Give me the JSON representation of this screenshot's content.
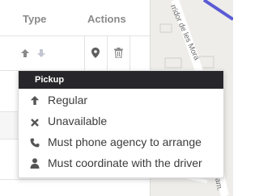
{
  "table": {
    "headers": {
      "type": "Type",
      "actions": "Actions"
    }
  },
  "icons": {
    "arrow_up": "arrow-up-icon",
    "arrow_down": "arrow-down-icon",
    "pin": "map-pin-icon",
    "trash": "trash-icon"
  },
  "map": {
    "street_label_1": "rridor de les Mora",
    "street_label_2": "am."
  },
  "menu": {
    "header": "Pickup",
    "items": [
      {
        "label": "Regular",
        "icon": "arrow-up-icon"
      },
      {
        "label": "Unavailable",
        "icon": "close-icon"
      },
      {
        "label": "Must phone agency to arrange",
        "icon": "phone-icon"
      },
      {
        "label": "Must coordinate with the driver",
        "icon": "user-icon"
      }
    ]
  },
  "colors": {
    "menu_header_bg": "#27272b",
    "route_blue": "#5b5bd6",
    "map_bg": "#eeede9"
  }
}
